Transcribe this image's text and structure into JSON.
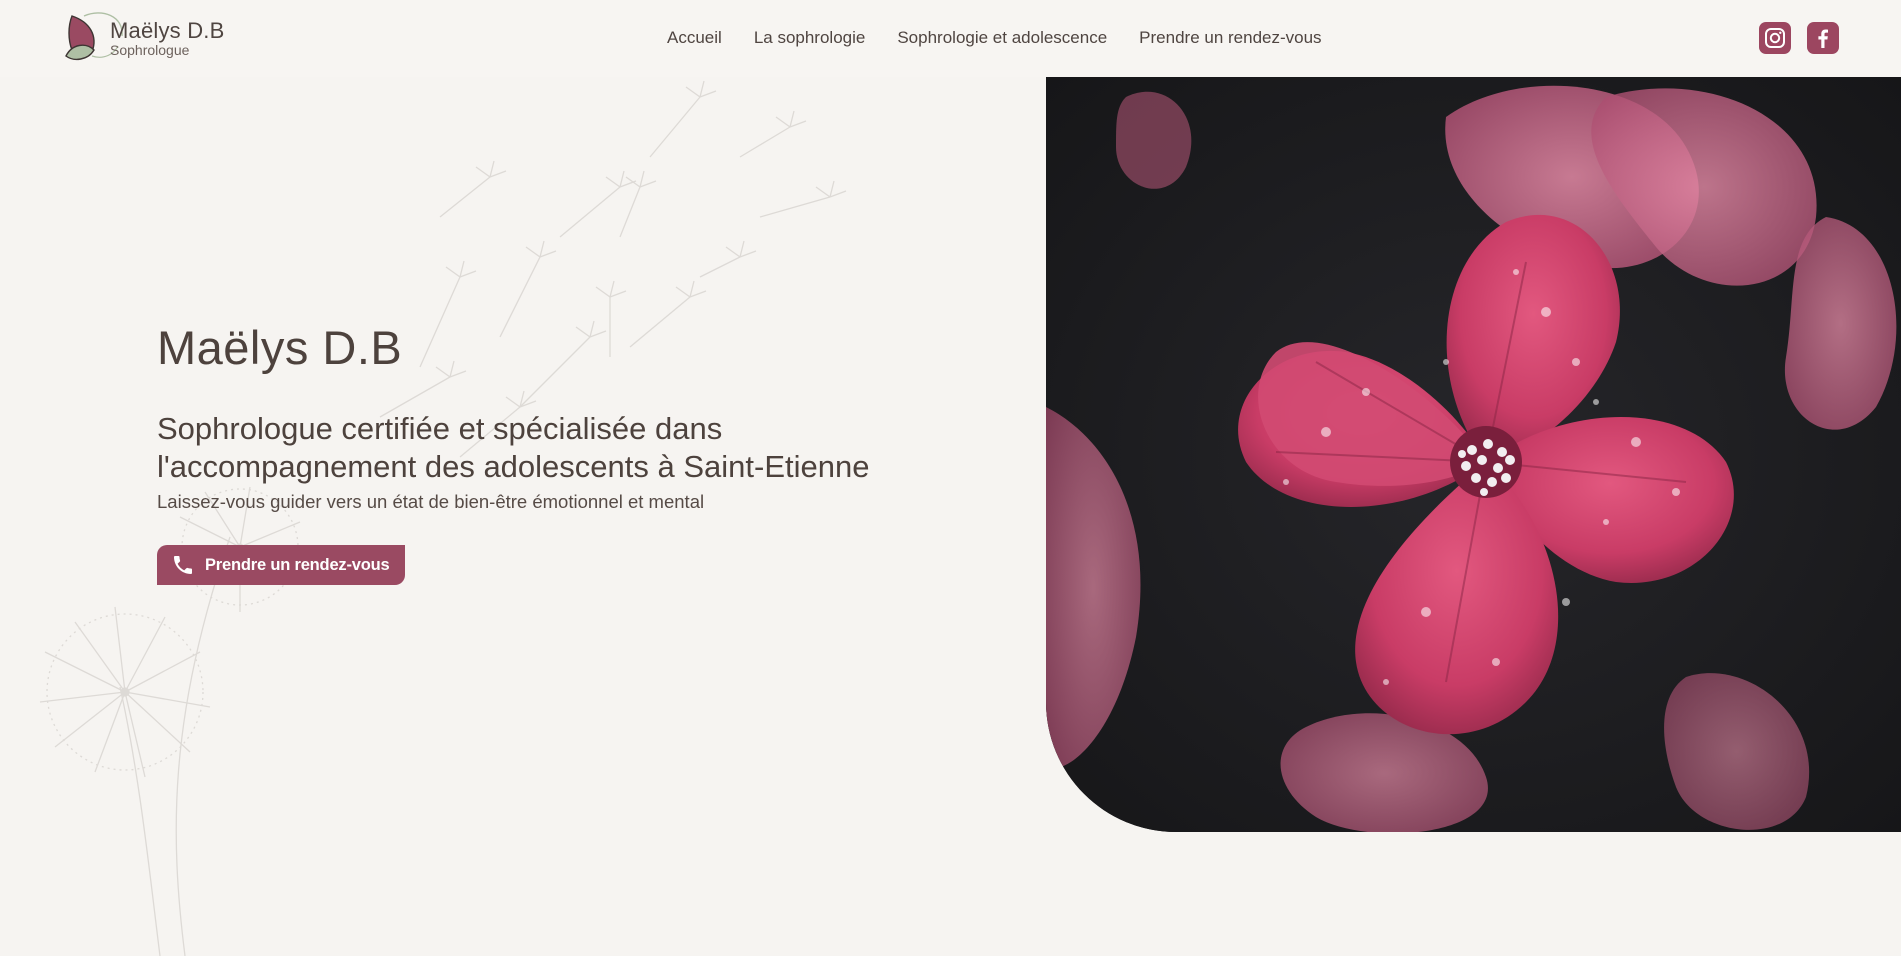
{
  "brand": {
    "name": "Maëlys D.B",
    "subtitle": "Sophrologue",
    "accent": "#9a4a62"
  },
  "nav": {
    "items": [
      {
        "label": "Accueil"
      },
      {
        "label": "La sophrologie"
      },
      {
        "label": "Sophrologie et adolescence"
      },
      {
        "label": "Prendre un rendez-vous"
      }
    ]
  },
  "socials": {
    "instagram_icon": "instagram-icon",
    "facebook_icon": "facebook-icon"
  },
  "hero": {
    "title": "Maëlys D.B",
    "subtitle": "Sophrologue certifiée et spécialisée dans l'accompagnement des adolescents à Saint-Etienne",
    "tagline": "Laissez-vous guider vers un état de bien-être émotionnel et mental",
    "cta_label": "Prendre un rendez-vous",
    "cta_icon": "phone-icon",
    "image_alt": "pink-flower-photo"
  }
}
